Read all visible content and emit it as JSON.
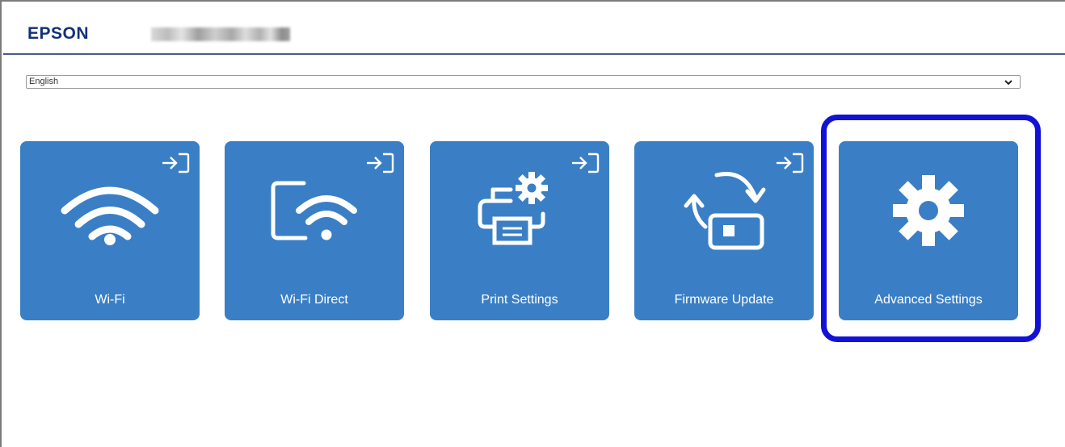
{
  "header": {
    "brand": "EPSON"
  },
  "language": {
    "selected": "English"
  },
  "tiles": [
    {
      "label": "Wi-Fi",
      "icon": "wifi-icon",
      "login": true
    },
    {
      "label": "Wi-Fi Direct",
      "icon": "wifi-direct-icon",
      "login": true
    },
    {
      "label": "Print Settings",
      "icon": "printer-settings-icon",
      "login": true
    },
    {
      "label": "Firmware Update",
      "icon": "firmware-update-icon",
      "login": true
    },
    {
      "label": "Advanced Settings",
      "icon": "gear-icon",
      "login": false
    }
  ],
  "colors": {
    "tile": "#3a7fc6",
    "brand": "#12307a",
    "highlight": "#1212d6"
  }
}
